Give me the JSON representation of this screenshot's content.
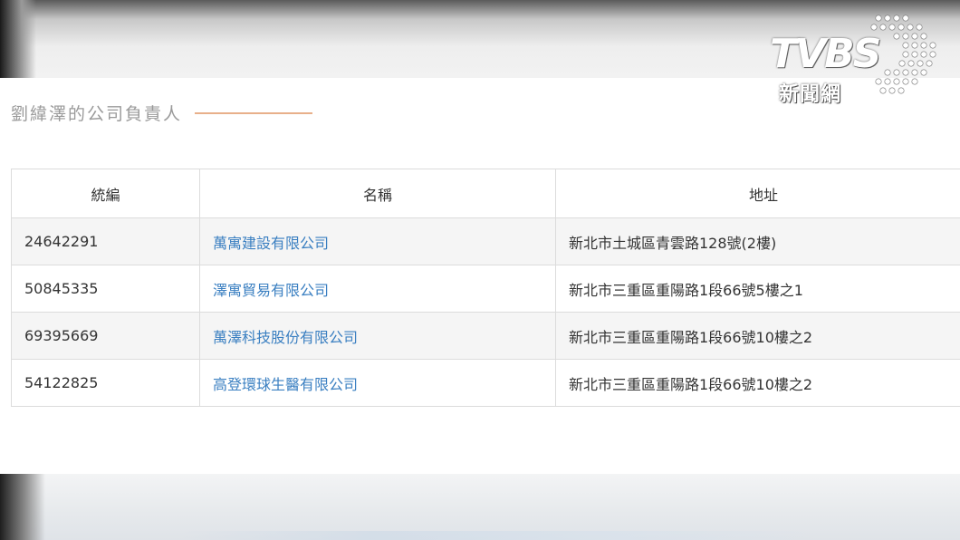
{
  "watermark": {
    "logo_text": "TVBS",
    "logo_sub": "新聞網"
  },
  "section": {
    "title": "劉緯澤的公司負責人"
  },
  "table": {
    "headers": [
      "統編",
      "名稱",
      "地址"
    ],
    "rows": [
      {
        "id": "24642291",
        "name": "萬寓建設有限公司",
        "address": "新北市土城區青雲路128號(2樓)"
      },
      {
        "id": "50845335",
        "name": "澤寓貿易有限公司",
        "address": "新北市三重區重陽路1段66號5樓之1"
      },
      {
        "id": "69395669",
        "name": "萬澤科技股份有限公司",
        "address": "新北市三重區重陽路1段66號10樓之2"
      },
      {
        "id": "54122825",
        "name": "高登環球生醫有限公司",
        "address": "新北市三重區重陽路1段66號10樓之2"
      }
    ]
  },
  "colors": {
    "link": "#3a7fc1",
    "title_line": "#e8b08a",
    "title_text": "#9a9a9a"
  }
}
